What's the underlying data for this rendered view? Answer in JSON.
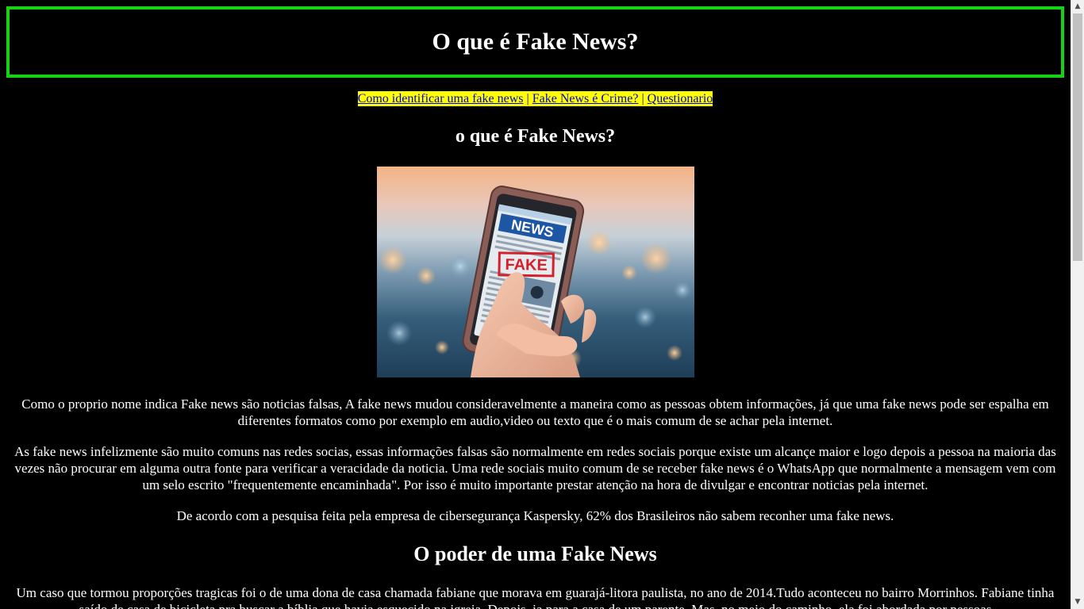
{
  "header": {
    "title": "O que é Fake News?"
  },
  "nav": {
    "items": [
      {
        "label": "Como identificar uma fake news"
      },
      {
        "label": "Fake News é Crime?"
      },
      {
        "label": "Questionario"
      }
    ],
    "separator": " | "
  },
  "main": {
    "section1_title": "o que é Fake News?",
    "image": {
      "alt": "NEWS FAKE",
      "screen_heading": "NEWS",
      "stamp": "FAKE"
    },
    "paragraphs": [
      "Como o proprio nome indica Fake news são noticias falsas, A fake news mudou consideravelmente a maneira como as pessoas obtem informações, já que uma fake news pode ser espalha em diferentes formatos como por exemplo em audio,video ou texto que é o mais comum de se achar pela internet.",
      "As fake news infelizmente são muito comuns nas redes socias, essas informações falsas são normalmente em redes sociais porque existe um alcançe maior e logo depois a pessoa na maioria das vezes não procurar em alguma outra fonte para verificar a veracidade da noticia. Uma rede sociais muito comum de se receber fake news é o WhatsApp que normalmente a mensagem vem com um selo escrito \"frequentemente encaminhada\". Por isso é muito importante prestar atenção na hora de divulgar e encontrar noticias pela internet.",
      "De acordo com a pesquisa feita pela empresa de cibersegurança Kaspersky, 62% dos Brasileiros não sabem reconher uma fake news."
    ],
    "section2_title": "O poder de uma Fake News",
    "paragraph4": "Um caso que tormou proporções tragicas foi o de uma dona de casa chamada fabiane que morava em guarajá-litora paulista, no ano de 2014.Tudo aconteceu no bairro Morrinhos. Fabiane tinha saído de casa de bicicleta pra buscar a bíblia que havia esquecido na igreja. Depois, ia para a casa de um parente. Mas, no meio do caminho, ela foi abordada por pessoas"
  },
  "colors": {
    "page_background": "#000000",
    "header_border": "#13d313",
    "nav_background": "#ffff00",
    "link": "#0000ee",
    "text": "#ffffff"
  }
}
